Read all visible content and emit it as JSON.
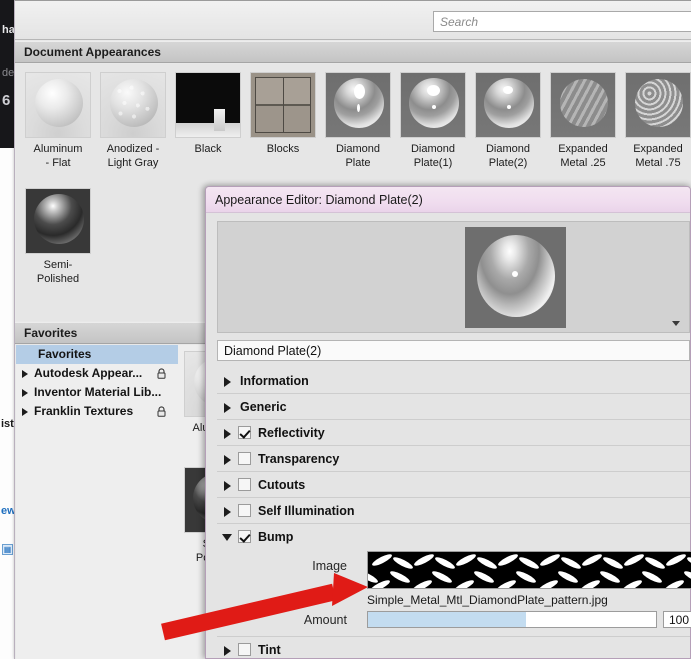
{
  "background_app": {
    "fragment_top": "ha",
    "fragment_mid": "de",
    "fragment_glyph": "6",
    "fragment_list": "ist",
    "fragment_link": "ew",
    "fragment_icon": "▦"
  },
  "browser": {
    "search": {
      "placeholder": "Search",
      "value": ""
    },
    "document_appearances": {
      "header": "Document Appearances",
      "items": [
        {
          "label": "Aluminum\n- Flat",
          "swatch": "t-alum"
        },
        {
          "label": "Anodized -\nLight Gray",
          "swatch": "t-anod"
        },
        {
          "label": "Black",
          "swatch": "t-black"
        },
        {
          "label": "Blocks",
          "swatch": "t-blocks"
        },
        {
          "label": "Diamond\nPlate",
          "swatch": "t-dp"
        },
        {
          "label": "Diamond\nPlate(1)",
          "swatch": "t-dp"
        },
        {
          "label": "Diamond\nPlate(2)",
          "swatch": "t-dp"
        },
        {
          "label": "Expanded\nMetal .25",
          "swatch": "t-exp025"
        },
        {
          "label": "Expanded\nMetal .75",
          "swatch": "t-exp075"
        },
        {
          "label": "Semi-\nPolished",
          "swatch": "t-semi"
        }
      ]
    },
    "favorites": {
      "header": "Favorites",
      "items": [
        {
          "label": "Favorites",
          "selected": true,
          "expandable": false,
          "locked": false
        },
        {
          "label": "Autodesk Appear...",
          "selected": false,
          "expandable": true,
          "locked": true
        },
        {
          "label": "Inventor Material Lib...",
          "selected": false,
          "expandable": true,
          "locked": false
        },
        {
          "label": "Franklin Textures",
          "selected": false,
          "expandable": true,
          "locked": true
        }
      ]
    }
  },
  "dialog": {
    "title": "Appearance Editor: Diamond Plate(2)",
    "name_field_value": "Diamond Plate(2)",
    "preview_dropdown_icon": "chevron-down-icon",
    "properties": [
      {
        "label": "Information",
        "has_checkbox": false,
        "checked": false,
        "expanded": false
      },
      {
        "label": "Generic",
        "has_checkbox": false,
        "checked": false,
        "expanded": false
      },
      {
        "label": "Reflectivity",
        "has_checkbox": true,
        "checked": true,
        "expanded": false
      },
      {
        "label": "Transparency",
        "has_checkbox": true,
        "checked": false,
        "expanded": false
      },
      {
        "label": "Cutouts",
        "has_checkbox": true,
        "checked": false,
        "expanded": false
      },
      {
        "label": "Self Illumination",
        "has_checkbox": true,
        "checked": false,
        "expanded": false
      },
      {
        "label": "Bump",
        "has_checkbox": true,
        "checked": true,
        "expanded": true
      },
      {
        "label": "Tint",
        "has_checkbox": true,
        "checked": false,
        "expanded": false
      }
    ],
    "bump": {
      "image_label": "Image",
      "image_filename": "Simple_Metal_Mtl_DiamondPlate_pattern.jpg",
      "amount_label": "Amount",
      "amount_value": "100",
      "amount_fill_percent": 55
    }
  },
  "annotation": {
    "arrow_color": "#e01b16",
    "arrow_name": "red-pointer-arrow"
  }
}
